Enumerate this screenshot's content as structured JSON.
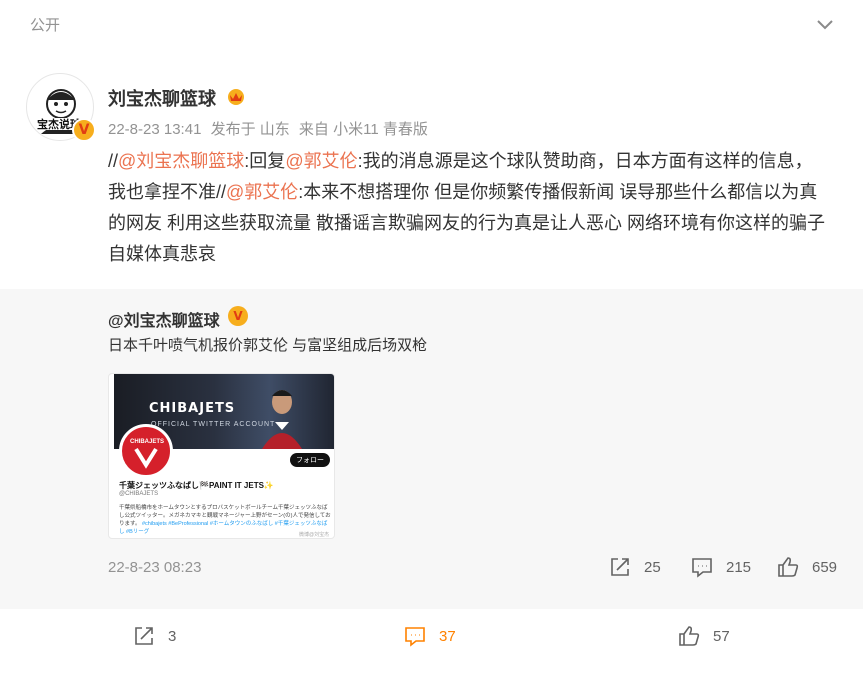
{
  "header": {
    "visibility": "公开"
  },
  "post": {
    "author": "刘宝杰聊篮球",
    "time": "22-8-23 13:41",
    "location": "发布于 山东",
    "source": "来自 小米11 青春版",
    "content": {
      "p1": "//",
      "m1": "@刘宝杰聊篮球",
      "p2": ":回复",
      "m2": "@郭艾伦",
      "p3": ":我的消息源是这个球队赞助商，日本方面有这样的信息，我也拿捏不准//",
      "m3": "@郭艾伦",
      "p4": ":本来不想搭理你 但是你频繁传播假新闻 误导那些什么都信以为真的网友 利用这些获取流量 散播谣言欺骗网友的行为真是让人恶心 网络环境有你这样的骗子自媒体真悲哀"
    }
  },
  "quoted": {
    "author": "@刘宝杰聊篮球",
    "text": "日本千叶喷气机报价郭艾伦 与富坚组成后场双枪",
    "image": {
      "banner_title": "CHIBAJETS",
      "banner_sub": "OFFICIAL TWITTER ACCOUNT",
      "logo_text": "CHIBAJETS",
      "follow": "フォロー",
      "account_name": "千葉ジェッツふなばし🏁PAINT IT JETS✨",
      "handle": "@CHIBAJETS",
      "bio": "千葉県船橋市をホームタウンとするプロバスケットボールチーム千葉ジェッツふなばし公式ツイッター。メガネカマキと観戦マネージャー上野がセーン(の)人で発信しております。",
      "bio_tags": "#chibajets #BeProfessional #ホームタウンのふなばし #千葉ジェッツふなばし #Bリーグ",
      "watermark": "微博@刘宝杰聊篮球"
    },
    "time": "22-8-23 08:23",
    "stats": {
      "reposts": "25",
      "comments": "215",
      "likes": "659"
    }
  },
  "footer": {
    "reposts": "3",
    "comments": "37",
    "likes": "57"
  },
  "colors": {
    "mention": "#eb7350",
    "accent": "#ff8200",
    "quote_bg": "#f7f7f7",
    "meta": "#939393"
  },
  "icons": [
    "chevron-down-icon",
    "crown-icon",
    "verified-badge-icon",
    "repost-icon",
    "comment-icon",
    "like-icon"
  ]
}
